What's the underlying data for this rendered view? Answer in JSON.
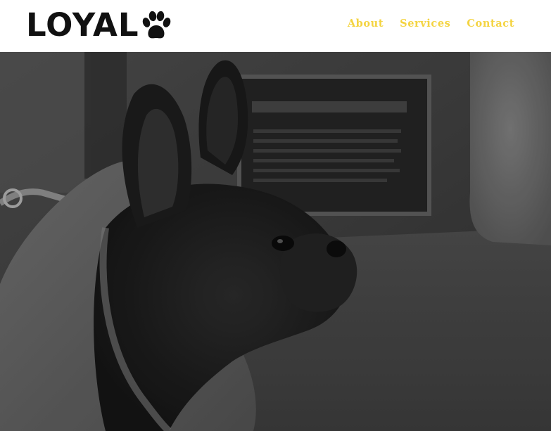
{
  "brand": {
    "name": "LOYAL",
    "logo_icon": "paw-icon"
  },
  "nav": {
    "items": [
      {
        "label": "About"
      },
      {
        "label": "Services"
      },
      {
        "label": "Contact"
      }
    ],
    "color": "#f4d442"
  },
  "hero": {
    "image": "grayscale photo of a French bulldog in a grey hoodie looking to the right"
  }
}
